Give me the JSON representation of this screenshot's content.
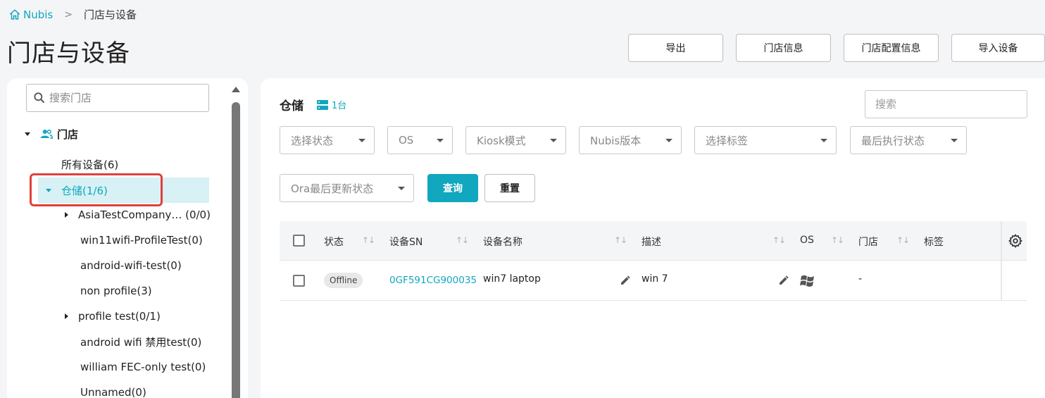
{
  "breadcrumb": {
    "home": "Nubis",
    "separator": ">",
    "current": "门店与设备"
  },
  "page_title": "门店与设备",
  "toolbar": {
    "export": "导出",
    "store_info": "门店信息",
    "store_config": "门店配置信息",
    "import_device": "导入设备"
  },
  "sidebar": {
    "search_placeholder": "搜索门店",
    "root_label": "门店",
    "all_devices": "所有设备(6)",
    "selected": "仓储(1/6)",
    "children": [
      "AsiaTestCompany… (0/0)",
      "win11wifi-ProfileTest(0)",
      "android-wifi-test(0)",
      "non profile(3)",
      "profile test(0/1)",
      "android wifi 禁用test(0)",
      "william FEC-only test(0)",
      "Unnamed(0)"
    ]
  },
  "main": {
    "title": "仓储",
    "count": "1台",
    "search_placeholder": "搜索",
    "filters": [
      "选择状态",
      "OS",
      "Kiosk模式",
      "Nubis版本",
      "选择标签",
      "最后执行状态",
      "Ora最后更新状态"
    ],
    "query": "查询",
    "reset": "重置",
    "table": {
      "headers": {
        "status": "状态",
        "sn": "设备SN",
        "name": "设备名称",
        "desc": "描述",
        "os": "OS",
        "store": "门店",
        "tags": "标签"
      },
      "sort_glyph": "↑↓",
      "rows": [
        {
          "status": "Offline",
          "sn": "0GF591CG900035",
          "name": "win7 laptop",
          "desc": "win 7",
          "store": "-"
        }
      ]
    }
  },
  "colors": {
    "accent": "#11a7be",
    "highlight": "#e1403a"
  }
}
